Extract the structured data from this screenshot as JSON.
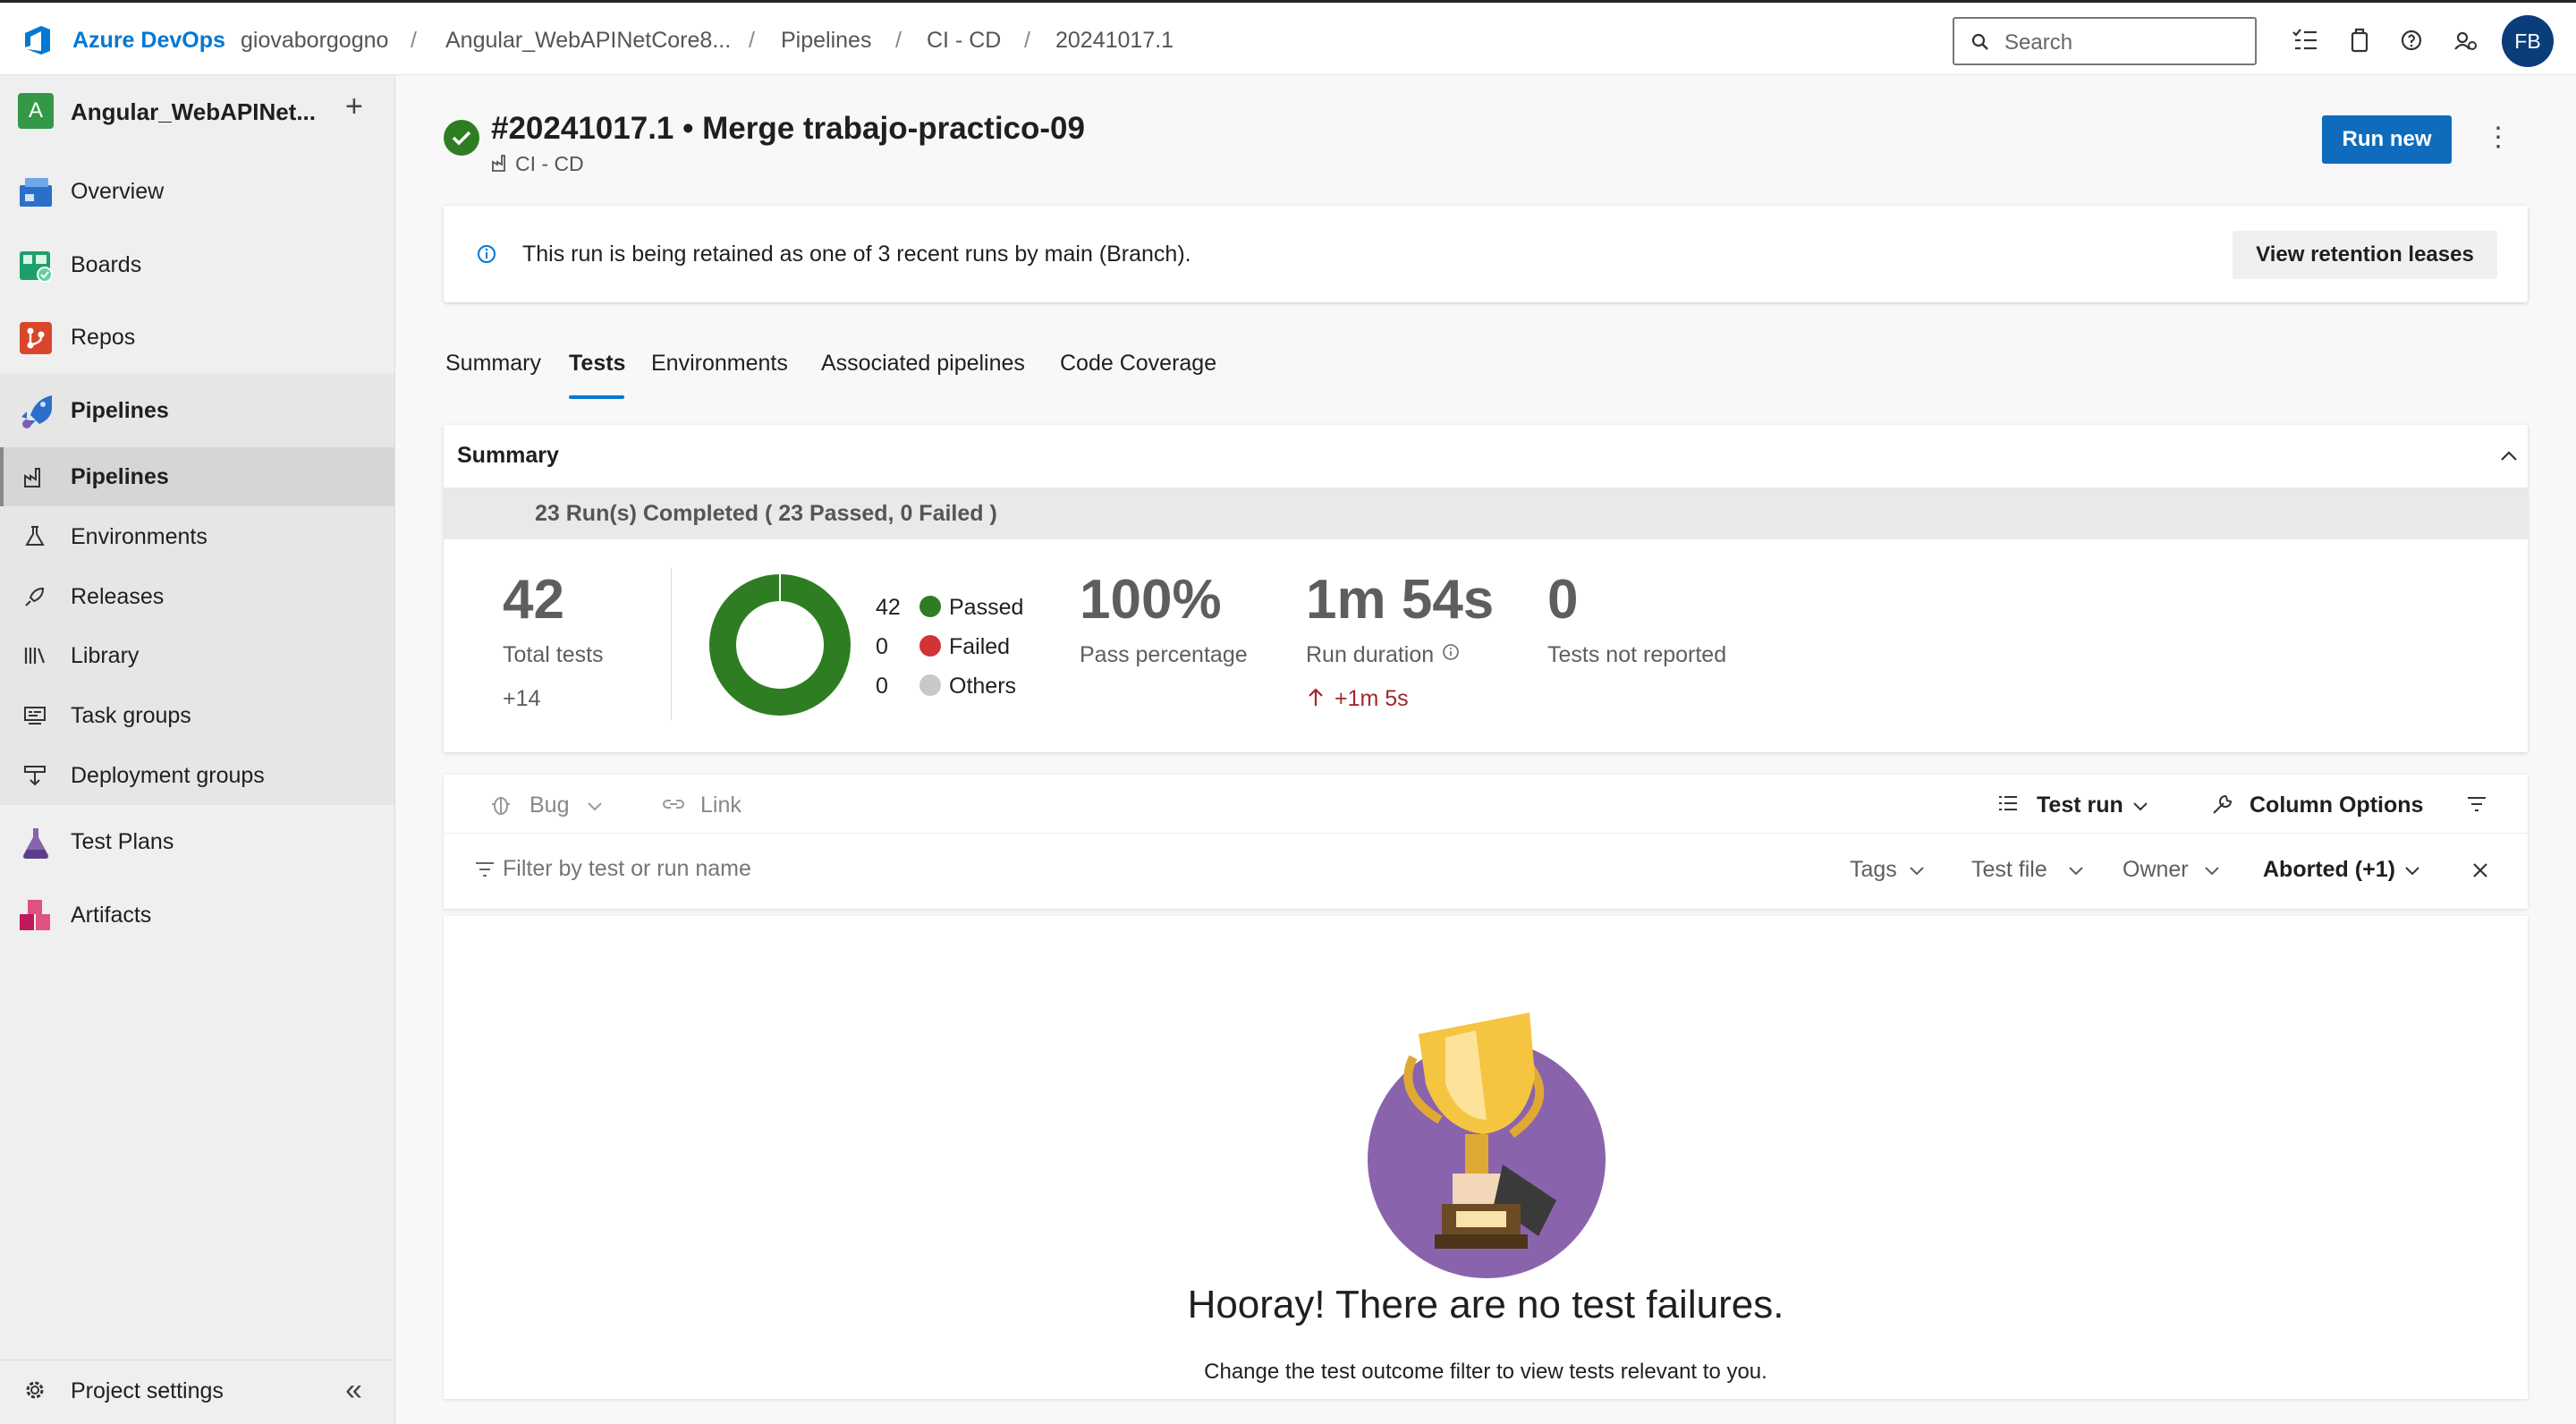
{
  "topbar": {
    "product": "Azure DevOps",
    "breadcrumbs": [
      "giovaborgogno",
      "Angular_WebAPINetCore8...",
      "Pipelines",
      "CI - CD",
      "20241017.1"
    ],
    "separator": "/",
    "search_placeholder": "Search",
    "avatar_initials": "FB"
  },
  "sidebar": {
    "project_initial": "A",
    "project_name": "Angular_WebAPINet...",
    "add_symbol": "+",
    "items": [
      {
        "label": "Overview",
        "icon": "overview-icon"
      },
      {
        "label": "Boards",
        "icon": "boards-icon"
      },
      {
        "label": "Repos",
        "icon": "repos-icon"
      },
      {
        "label": "Pipelines",
        "icon": "pipelines-icon"
      },
      {
        "label": "Test Plans",
        "icon": "test-plans-icon"
      },
      {
        "label": "Artifacts",
        "icon": "artifacts-icon"
      }
    ],
    "pipeline_sub": [
      {
        "label": "Pipelines",
        "icon": "pipeline-factory-icon",
        "selected": true
      },
      {
        "label": "Environments",
        "icon": "environments-icon"
      },
      {
        "label": "Releases",
        "icon": "releases-icon"
      },
      {
        "label": "Library",
        "icon": "library-icon"
      },
      {
        "label": "Task groups",
        "icon": "task-groups-icon"
      },
      {
        "label": "Deployment groups",
        "icon": "deployment-groups-icon"
      }
    ],
    "footer": {
      "label": "Project settings",
      "collapse_symbol": "«"
    }
  },
  "run": {
    "title": "#20241017.1 • Merge trabajo-practico-09",
    "pipeline": "CI - CD",
    "status": "succeeded",
    "run_new_label": "Run new",
    "more_symbol": "⋮"
  },
  "banner": {
    "message": "This run is being retained as one of 3 recent runs by main (Branch).",
    "button": "View retention leases"
  },
  "tabs": [
    "Summary",
    "Tests",
    "Environments",
    "Associated pipelines",
    "Code Coverage"
  ],
  "active_tab": "Tests",
  "summary": {
    "heading": "Summary",
    "runs_text": "23 Run(s) Completed ( 23 Passed, 0 Failed )",
    "total_tests": "42",
    "total_label": "Total tests",
    "total_delta": "+14",
    "legend": [
      {
        "count": "42",
        "label": "Passed",
        "color": "#2f7d23"
      },
      {
        "count": "0",
        "label": "Failed",
        "color": "#d13438"
      },
      {
        "count": "0",
        "label": "Others",
        "color": "#c8c8c8"
      }
    ],
    "pass_pct": "100%",
    "pass_label": "Pass percentage",
    "duration": "1m 54s",
    "duration_label": "Run duration",
    "duration_delta": "+1m 5s",
    "not_reported": "0",
    "not_reported_label": "Tests not reported"
  },
  "toolbar": {
    "bug": "Bug",
    "link": "Link",
    "group_by": "Test run",
    "column_options": "Column Options",
    "filter_placeholder": "Filter by test or run name",
    "filters": [
      "Tags",
      "Test file",
      "Owner"
    ],
    "outcome_filter": "Aborted (+1)"
  },
  "results": {
    "empty_title": "Hooray! There are no test failures.",
    "empty_sub": "Change the test outcome filter to view tests relevant to you."
  },
  "colors": {
    "accent": "#0078d4",
    "success": "#2f7d23",
    "purple": "#8a63ad",
    "delta_red": "#a4262c"
  }
}
